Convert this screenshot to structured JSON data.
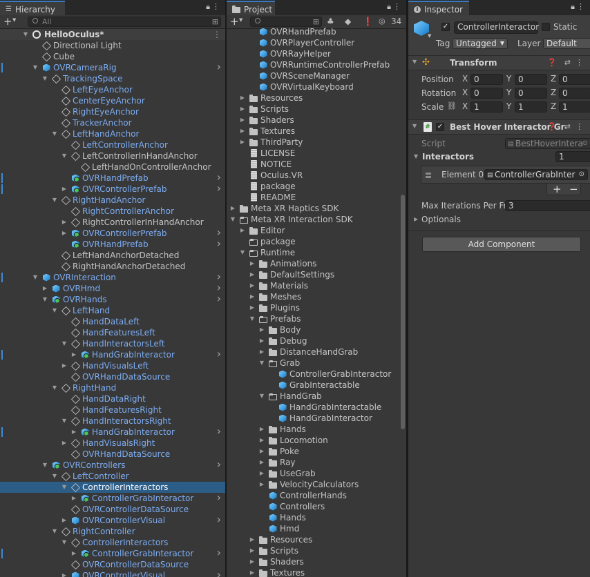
{
  "hierarchy": {
    "tab_label": "Hierarchy",
    "search_placeholder": "All",
    "scene_name": "HelloOculus*",
    "items": [
      {
        "label": "Directional Light",
        "depth": 1,
        "icon": "go",
        "arrow": "",
        "prefab": false
      },
      {
        "label": "Cube",
        "depth": 1,
        "icon": "go",
        "arrow": "",
        "prefab": false
      },
      {
        "label": "OVRCameraRig",
        "depth": 1,
        "icon": "cube",
        "arrow": "open",
        "prefab": true,
        "more": true,
        "mark": true
      },
      {
        "label": "TrackingSpace",
        "depth": 2,
        "icon": "go",
        "arrow": "open",
        "prefab": true
      },
      {
        "label": "LeftEyeAnchor",
        "depth": 3,
        "icon": "go",
        "arrow": "",
        "prefab": true
      },
      {
        "label": "CenterEyeAnchor",
        "depth": 3,
        "icon": "go",
        "arrow": "",
        "prefab": true
      },
      {
        "label": "RightEyeAnchor",
        "depth": 3,
        "icon": "go",
        "arrow": "",
        "prefab": true
      },
      {
        "label": "TrackerAnchor",
        "depth": 3,
        "icon": "go",
        "arrow": "",
        "prefab": true
      },
      {
        "label": "LeftHandAnchor",
        "depth": 3,
        "icon": "go",
        "arrow": "open",
        "prefab": true
      },
      {
        "label": "LeftControllerAnchor",
        "depth": 4,
        "icon": "go",
        "arrow": "",
        "prefab": true
      },
      {
        "label": "LeftControllerInHandAnchor",
        "depth": 4,
        "icon": "gogreen",
        "arrow": "open",
        "prefab": false
      },
      {
        "label": "LeftHandOnControllerAnchor",
        "depth": 5,
        "icon": "go",
        "arrow": "",
        "prefab": false
      },
      {
        "label": "OVRHandPrefab",
        "depth": 4,
        "icon": "cubeg",
        "arrow": "",
        "prefab": true,
        "more": true,
        "mark": true
      },
      {
        "label": "OVRControllerPrefab",
        "depth": 4,
        "icon": "cubeg",
        "arrow": "closed",
        "prefab": true,
        "more": true,
        "mark": true
      },
      {
        "label": "RightHandAnchor",
        "depth": 3,
        "icon": "go",
        "arrow": "open",
        "prefab": true
      },
      {
        "label": "RightControllerAnchor",
        "depth": 4,
        "icon": "go",
        "arrow": "",
        "prefab": true
      },
      {
        "label": "RightControllerInHandAnchor",
        "depth": 4,
        "icon": "go",
        "arrow": "closed",
        "prefab": false
      },
      {
        "label": "OVRControllerPrefab",
        "depth": 4,
        "icon": "cubeg",
        "arrow": "closed",
        "prefab": true,
        "more": true
      },
      {
        "label": "OVRHandPrefab",
        "depth": 4,
        "icon": "cubeg",
        "arrow": "",
        "prefab": true,
        "more": true
      },
      {
        "label": "LeftHandAnchorDetached",
        "depth": 3,
        "icon": "go",
        "arrow": "",
        "prefab": false
      },
      {
        "label": "RightHandAnchorDetached",
        "depth": 3,
        "icon": "go",
        "arrow": "",
        "prefab": false
      },
      {
        "label": "OVRInteraction",
        "depth": 1,
        "icon": "cube",
        "arrow": "open",
        "prefab": true,
        "more": true,
        "mark": true
      },
      {
        "label": "OVRHmd",
        "depth": 2,
        "icon": "cube",
        "arrow": "closed",
        "prefab": true,
        "more": true
      },
      {
        "label": "OVRHands",
        "depth": 2,
        "icon": "cubeg",
        "arrow": "open",
        "prefab": true,
        "more": true
      },
      {
        "label": "LeftHand",
        "depth": 3,
        "icon": "go",
        "arrow": "open",
        "prefab": true
      },
      {
        "label": "HandDataLeft",
        "depth": 4,
        "icon": "go",
        "arrow": "",
        "prefab": true
      },
      {
        "label": "HandFeaturesLeft",
        "depth": 4,
        "icon": "go",
        "arrow": "",
        "prefab": true
      },
      {
        "label": "HandInteractorsLeft",
        "depth": 4,
        "icon": "go",
        "arrow": "open",
        "prefab": true
      },
      {
        "label": "HandGrabInteractor",
        "depth": 5,
        "icon": "cubeg",
        "arrow": "closed",
        "prefab": true,
        "more": true,
        "mark": true
      },
      {
        "label": "HandVisualsLeft",
        "depth": 4,
        "icon": "go",
        "arrow": "closed",
        "prefab": true
      },
      {
        "label": "OVRHandDataSource",
        "depth": 4,
        "icon": "go",
        "arrow": "",
        "prefab": true
      },
      {
        "label": "RightHand",
        "depth": 3,
        "icon": "go",
        "arrow": "open",
        "prefab": true
      },
      {
        "label": "HandDataRight",
        "depth": 4,
        "icon": "go",
        "arrow": "",
        "prefab": true
      },
      {
        "label": "HandFeaturesRight",
        "depth": 4,
        "icon": "go",
        "arrow": "",
        "prefab": true
      },
      {
        "label": "HandInteractorsRight",
        "depth": 4,
        "icon": "go",
        "arrow": "open",
        "prefab": true
      },
      {
        "label": "HandGrabInteractor",
        "depth": 5,
        "icon": "cubeg",
        "arrow": "closed",
        "prefab": true,
        "more": true,
        "mark": true
      },
      {
        "label": "HandVisualsRight",
        "depth": 4,
        "icon": "go",
        "arrow": "closed",
        "prefab": true
      },
      {
        "label": "OVRHandDataSource",
        "depth": 4,
        "icon": "go",
        "arrow": "",
        "prefab": true
      },
      {
        "label": "OVRControllers",
        "depth": 2,
        "icon": "cubeg",
        "arrow": "open",
        "prefab": true,
        "more": true
      },
      {
        "label": "LeftController",
        "depth": 3,
        "icon": "go",
        "arrow": "open",
        "prefab": true
      },
      {
        "label": "ControllerInteractors",
        "depth": 4,
        "icon": "go",
        "arrow": "open",
        "prefab": false,
        "selected": true
      },
      {
        "label": "ControllerGrabInteractor",
        "depth": 5,
        "icon": "cubeg",
        "arrow": "closed",
        "prefab": true,
        "more": true
      },
      {
        "label": "OVRControllerDataSource",
        "depth": 4,
        "icon": "go",
        "arrow": "",
        "prefab": true
      },
      {
        "label": "OVRControllerVisual",
        "depth": 4,
        "icon": "cube",
        "arrow": "closed",
        "prefab": true,
        "more": true
      },
      {
        "label": "RightController",
        "depth": 3,
        "icon": "go",
        "arrow": "open",
        "prefab": true
      },
      {
        "label": "ControllerInteractors",
        "depth": 4,
        "icon": "go",
        "arrow": "open",
        "prefab": true
      },
      {
        "label": "ControllerGrabInteractor",
        "depth": 5,
        "icon": "cubeg",
        "arrow": "closed",
        "prefab": true,
        "more": true,
        "mark": true
      },
      {
        "label": "OVRControllerDataSource",
        "depth": 4,
        "icon": "go",
        "arrow": "",
        "prefab": true
      },
      {
        "label": "OVRControllerVisual",
        "depth": 4,
        "icon": "cube",
        "arrow": "closed",
        "prefab": true,
        "more": true
      }
    ]
  },
  "project": {
    "tab_label": "Project",
    "hidden_count": "34",
    "items": [
      {
        "label": "OVRHandPrefab",
        "depth": 3,
        "icon": "cube",
        "arrow": ""
      },
      {
        "label": "OVRPlayerController",
        "depth": 3,
        "icon": "cube",
        "arrow": ""
      },
      {
        "label": "OVRRayHelper",
        "depth": 3,
        "icon": "cube",
        "arrow": ""
      },
      {
        "label": "OVRRuntimeControllerPrefab",
        "depth": 3,
        "icon": "cube",
        "arrow": ""
      },
      {
        "label": "OVRSceneManager",
        "depth": 3,
        "icon": "cube",
        "arrow": ""
      },
      {
        "label": "OVRVirtualKeyboard",
        "depth": 3,
        "icon": "cube",
        "arrow": ""
      },
      {
        "label": "Resources",
        "depth": 2,
        "icon": "folder",
        "arrow": "closed"
      },
      {
        "label": "Scripts",
        "depth": 2,
        "icon": "folder",
        "arrow": "closed"
      },
      {
        "label": "Shaders",
        "depth": 2,
        "icon": "folder",
        "arrow": "closed"
      },
      {
        "label": "Textures",
        "depth": 2,
        "icon": "folder",
        "arrow": "closed"
      },
      {
        "label": "ThirdParty",
        "depth": 2,
        "icon": "folder",
        "arrow": "closed"
      },
      {
        "label": "LICENSE",
        "depth": 2,
        "icon": "doc",
        "arrow": ""
      },
      {
        "label": "NOTICE",
        "depth": 2,
        "icon": "doc",
        "arrow": ""
      },
      {
        "label": "Oculus.VR",
        "depth": 2,
        "icon": "doc",
        "arrow": ""
      },
      {
        "label": "package",
        "depth": 2,
        "icon": "doc",
        "arrow": ""
      },
      {
        "label": "README",
        "depth": 2,
        "icon": "doc",
        "arrow": ""
      },
      {
        "label": "Meta XR Haptics SDK",
        "depth": 1,
        "icon": "folder",
        "arrow": "closed"
      },
      {
        "label": "Meta XR Interaction SDK",
        "depth": 1,
        "icon": "folderopen",
        "arrow": "open"
      },
      {
        "label": "Editor",
        "depth": 2,
        "icon": "folder",
        "arrow": "closed"
      },
      {
        "label": "package",
        "depth": 2,
        "icon": "folderopen",
        "arrow": ""
      },
      {
        "label": "Runtime",
        "depth": 2,
        "icon": "folderopen",
        "arrow": "open"
      },
      {
        "label": "Animations",
        "depth": 3,
        "icon": "folder",
        "arrow": "closed"
      },
      {
        "label": "DefaultSettings",
        "depth": 3,
        "icon": "folder",
        "arrow": "closed"
      },
      {
        "label": "Materials",
        "depth": 3,
        "icon": "folder",
        "arrow": "closed"
      },
      {
        "label": "Meshes",
        "depth": 3,
        "icon": "folder",
        "arrow": "closed"
      },
      {
        "label": "Plugins",
        "depth": 3,
        "icon": "folder",
        "arrow": "closed"
      },
      {
        "label": "Prefabs",
        "depth": 3,
        "icon": "folderopen",
        "arrow": "open"
      },
      {
        "label": "Body",
        "depth": 4,
        "icon": "folder",
        "arrow": "closed"
      },
      {
        "label": "Debug",
        "depth": 4,
        "icon": "folder",
        "arrow": "closed"
      },
      {
        "label": "DistanceHandGrab",
        "depth": 4,
        "icon": "folder",
        "arrow": "closed"
      },
      {
        "label": "Grab",
        "depth": 4,
        "icon": "folderopen",
        "arrow": "open"
      },
      {
        "label": "ControllerGrabInteractor",
        "depth": 5,
        "icon": "cube",
        "arrow": ""
      },
      {
        "label": "GrabInteractable",
        "depth": 5,
        "icon": "cube",
        "arrow": ""
      },
      {
        "label": "HandGrab",
        "depth": 4,
        "icon": "folderopen",
        "arrow": "open"
      },
      {
        "label": "HandGrabInteractable",
        "depth": 5,
        "icon": "cube",
        "arrow": ""
      },
      {
        "label": "HandGrabInteractor",
        "depth": 5,
        "icon": "cube",
        "arrow": ""
      },
      {
        "label": "Hands",
        "depth": 4,
        "icon": "folder",
        "arrow": "closed"
      },
      {
        "label": "Locomotion",
        "depth": 4,
        "icon": "folder",
        "arrow": "closed"
      },
      {
        "label": "Poke",
        "depth": 4,
        "icon": "folder",
        "arrow": "closed"
      },
      {
        "label": "Ray",
        "depth": 4,
        "icon": "folder",
        "arrow": "closed"
      },
      {
        "label": "UseGrab",
        "depth": 4,
        "icon": "folder",
        "arrow": "closed"
      },
      {
        "label": "VelocityCalculators",
        "depth": 4,
        "icon": "folder",
        "arrow": "closed"
      },
      {
        "label": "ControllerHands",
        "depth": 4,
        "icon": "cube",
        "arrow": ""
      },
      {
        "label": "Controllers",
        "depth": 4,
        "icon": "cube",
        "arrow": ""
      },
      {
        "label": "Hands",
        "depth": 4,
        "icon": "cube",
        "arrow": ""
      },
      {
        "label": "Hmd",
        "depth": 4,
        "icon": "cube",
        "arrow": ""
      },
      {
        "label": "Resources",
        "depth": 3,
        "icon": "folder",
        "arrow": "closed"
      },
      {
        "label": "Scripts",
        "depth": 3,
        "icon": "folder",
        "arrow": "closed"
      },
      {
        "label": "Shaders",
        "depth": 3,
        "icon": "folder",
        "arrow": "closed"
      },
      {
        "label": "Textures",
        "depth": 3,
        "icon": "folder",
        "arrow": "closed"
      }
    ]
  },
  "inspector": {
    "tab_label": "Inspector",
    "object_name": "ControllerInteractor",
    "static_label": "Static",
    "tag_label": "Tag",
    "tag_value": "Untagged",
    "layer_label": "Layer",
    "layer_value": "Default",
    "transform": {
      "title": "Transform",
      "position_label": "Position",
      "rotation_label": "Rotation",
      "scale_label": "Scale",
      "x": "X",
      "y": "Y",
      "z": "Z",
      "position": [
        "0",
        "0",
        "0"
      ],
      "rotation": [
        "0",
        "0",
        "0"
      ],
      "scale": [
        "1",
        "1",
        "1"
      ]
    },
    "component": {
      "title": "Best Hover Interactor Gr",
      "script_label": "Script",
      "script_value": "BestHoverIntera",
      "interactors_label": "Interactors",
      "interactors_count": "1",
      "element_label": "Element 0",
      "element_value": "ControllerGrabInter",
      "plus": "+",
      "minus": "−",
      "max_iter_label": "Max Iterations Per Fra",
      "max_iter_value": "3",
      "optionals_label": "Optionals"
    },
    "add_component_label": "Add Component"
  }
}
